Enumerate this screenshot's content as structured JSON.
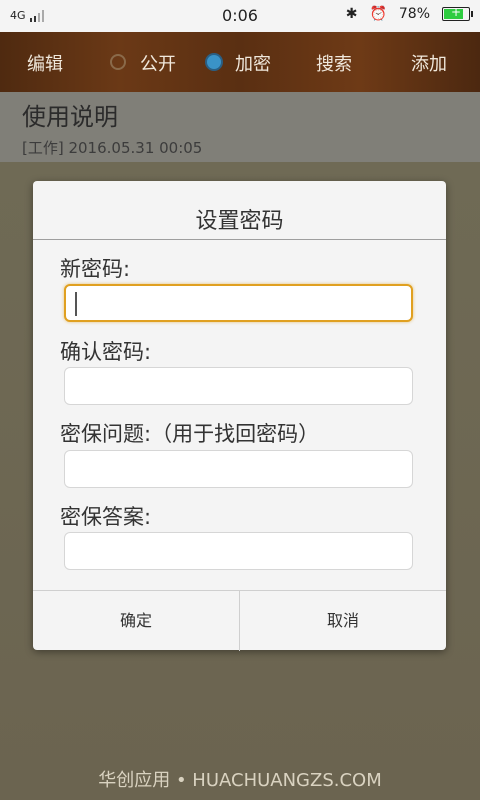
{
  "status_bar": {
    "network": "4G",
    "time": "0:06",
    "battery_percent": "78%",
    "battery_level": 0.78,
    "icons": [
      "signal-icon",
      "bluetooth-icon",
      "alarm-icon",
      "battery-icon"
    ]
  },
  "toolbar": {
    "edit": "编辑",
    "public": "公开",
    "encrypt": "加密",
    "search": "搜索",
    "add": "添加",
    "selected": "加密"
  },
  "note": {
    "title": "使用说明",
    "subtitle": "[工作] 2016.05.31 00:05"
  },
  "dialog": {
    "title": "设置密码",
    "fields": [
      {
        "label": "新密码:",
        "value": "",
        "focused": true
      },
      {
        "label": "确认密码:",
        "value": ""
      },
      {
        "label": "密保问题:（用于找回密码）",
        "value": ""
      },
      {
        "label": "密保答案:",
        "value": ""
      }
    ],
    "confirm": "确定",
    "cancel": "取消"
  },
  "watermark": "华创应用 • HUACHUANGZS.COM",
  "colors": {
    "accent_focus": "#e0a020",
    "radio_selected": "#3a93c8"
  }
}
